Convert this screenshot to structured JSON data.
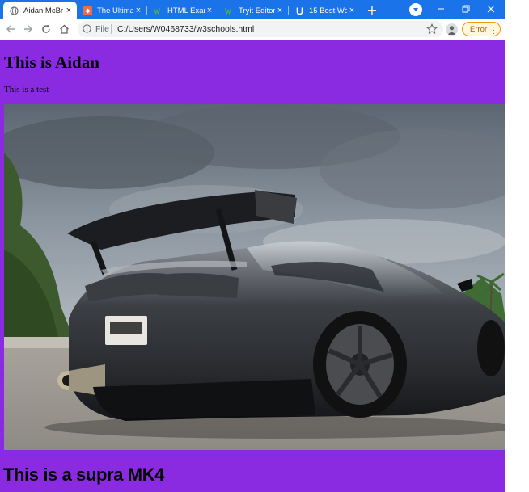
{
  "browser": {
    "tabs": [
      {
        "title": "Aidan McBr",
        "active": true,
        "favicon": "globe-icon"
      },
      {
        "title": "The Ultimat",
        "active": false,
        "favicon": "slides-icon"
      },
      {
        "title": "HTML Exam",
        "active": false,
        "favicon": "w3schools-icon"
      },
      {
        "title": "Tryit Editor",
        "active": false,
        "favicon": "w3schools-icon"
      },
      {
        "title": "15 Best We",
        "active": false,
        "favicon": "u-icon"
      }
    ],
    "new_tab_label": "+",
    "scheme_label": "File",
    "url": "C:/Users/W0468733/w3schools.html",
    "error_label": "Error",
    "accent_color": "#1a73e8",
    "error_color": "#f29900"
  },
  "page": {
    "background_color": "#8a2be2",
    "heading": "This is Aidan",
    "paragraph": "This is a test",
    "image_alt": "Toyota Supra MK4 rear view with large rear wing",
    "subheading": "This is a supra MK4"
  }
}
